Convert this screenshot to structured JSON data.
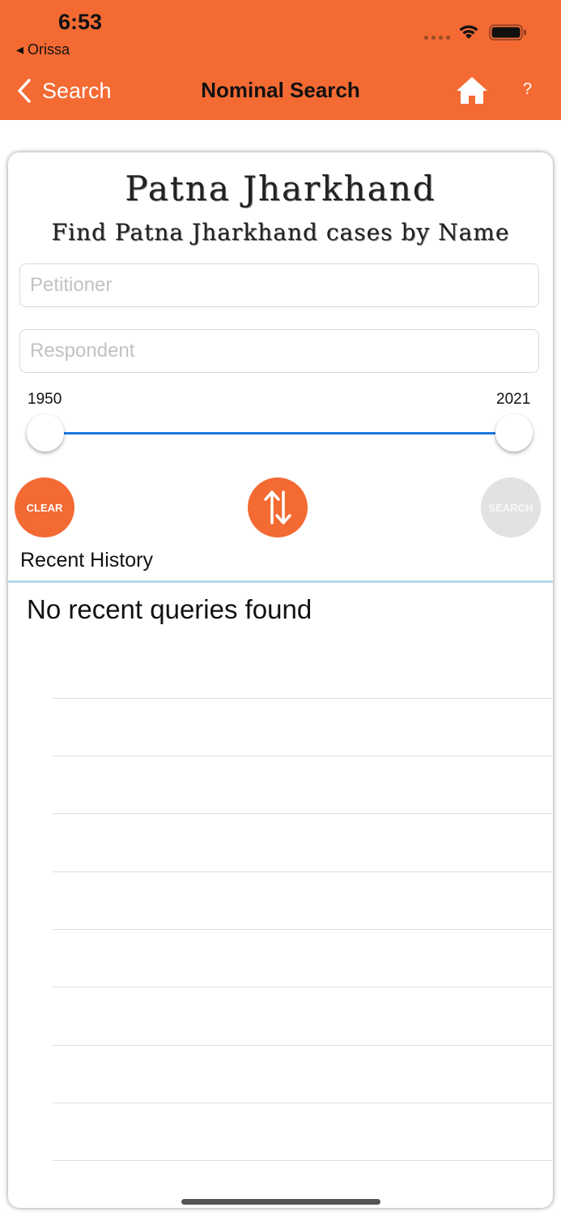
{
  "status_bar": {
    "time": "6:53",
    "back_app": "◂ Orissa"
  },
  "nav": {
    "back_label": "Search",
    "title": "Nominal Search",
    "help": "?"
  },
  "card": {
    "title": "Patna Jharkhand",
    "subtitle": "Find Patna Jharkhand cases by Name"
  },
  "form": {
    "petitioner_placeholder": "Petitioner",
    "respondent_placeholder": "Respondent"
  },
  "year_range": {
    "min_label": "1950",
    "max_label": "2021"
  },
  "buttons": {
    "clear": "CLEAR",
    "search": "SEARCH"
  },
  "history": {
    "heading": "Recent History",
    "empty_message": "No recent queries found"
  },
  "colors": {
    "accent": "#f46a33",
    "slider": "#1a7ae0",
    "divider": "#b7d8e8"
  }
}
